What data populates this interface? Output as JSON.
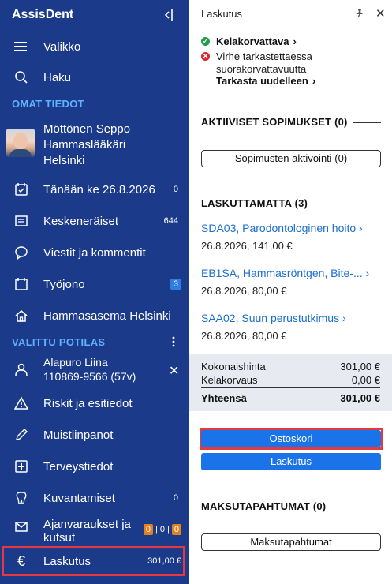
{
  "sidebar": {
    "brand": "AssisDent",
    "items_top": [
      {
        "label": "Valikko",
        "icon": "hamburger-icon"
      },
      {
        "label": "Haku",
        "icon": "search-icon"
      }
    ],
    "section_own": "OMAT TIEDOT",
    "profile": {
      "name": "Möttönen Seppo",
      "role": "Hammaslääkäri",
      "city": "Helsinki"
    },
    "items_own": [
      {
        "label": "Tänään ke 26.8.2026",
        "count": "0",
        "icon": "calendar-icon"
      },
      {
        "label": "Keskeneräiset",
        "count": "644",
        "icon": "document-icon"
      },
      {
        "label": "Viestit ja kommentit",
        "icon": "chat-icon"
      },
      {
        "label": "Työjono",
        "badge": "3",
        "icon": "calendar-icon"
      },
      {
        "label": "Hammasasema Helsinki",
        "icon": "home-icon"
      }
    ],
    "section_patient": "VALITTU POTILAS",
    "patient": {
      "name": "Alapuro Liina",
      "id": "110869-9566 (57v)"
    },
    "items_patient": [
      {
        "label": "Riskit ja esitiedot",
        "icon": "warning-icon"
      },
      {
        "label": "Muistiinpanot",
        "icon": "pencil-icon"
      },
      {
        "label": "Terveystiedot",
        "icon": "plus-box-icon"
      },
      {
        "label": "Kuvantamiset",
        "count": "0",
        "icon": "tooth-icon"
      },
      {
        "label": "Ajanvaraukset ja",
        "label2": "kutsut",
        "badges": [
          "0",
          "0",
          "0"
        ],
        "icon": "mail-icon"
      },
      {
        "label": "Laskutus",
        "amount": "301,00 €",
        "icon": "euro-icon"
      }
    ]
  },
  "panel": {
    "title": "Laskutus",
    "status_ok": "Kelakorvattava",
    "status_err_1": "Virhe tarkastettaessa",
    "status_err_2": "suorakorvattavuutta",
    "recheck": "Tarkasta uudelleen",
    "active_header": "AKTIIVISET SOPIMUKSET (0)",
    "activate_btn": "Sopimusten aktivointi (0)",
    "unbilled_header": "LASKUTTAMATTA (3)",
    "unbilled": [
      {
        "title": "SDA03, Parodontologinen hoito",
        "details": "26.8.2026, 141,00 €"
      },
      {
        "title": "EB1SA, Hammasröntgen, Bite-...",
        "details": "26.8.2026, 80,00 €"
      },
      {
        "title": "SAA02, Suun perustutkimus",
        "details": "26.8.2026, 80,00 €"
      }
    ],
    "totals": {
      "total_label": "Kokonaishinta",
      "total_value": "301,00 €",
      "kela_label": "Kelakorvaus",
      "kela_value": "0,00 €",
      "sum_label": "Yhteensä",
      "sum_value": "301,00 €"
    },
    "cart_btn": "Ostoskori",
    "billing_btn": "Laskutus",
    "payments_header": "MAKSUTAPAHTUMAT (0)",
    "payments_btn": "Maksutapahtumat"
  },
  "colors": {
    "sidebar": "#1b3a8a",
    "accent": "#1a73e8",
    "section": "#5fb0ff",
    "highlight": "#e5393f",
    "ok": "#1e9e4a",
    "error": "#d9282f"
  }
}
